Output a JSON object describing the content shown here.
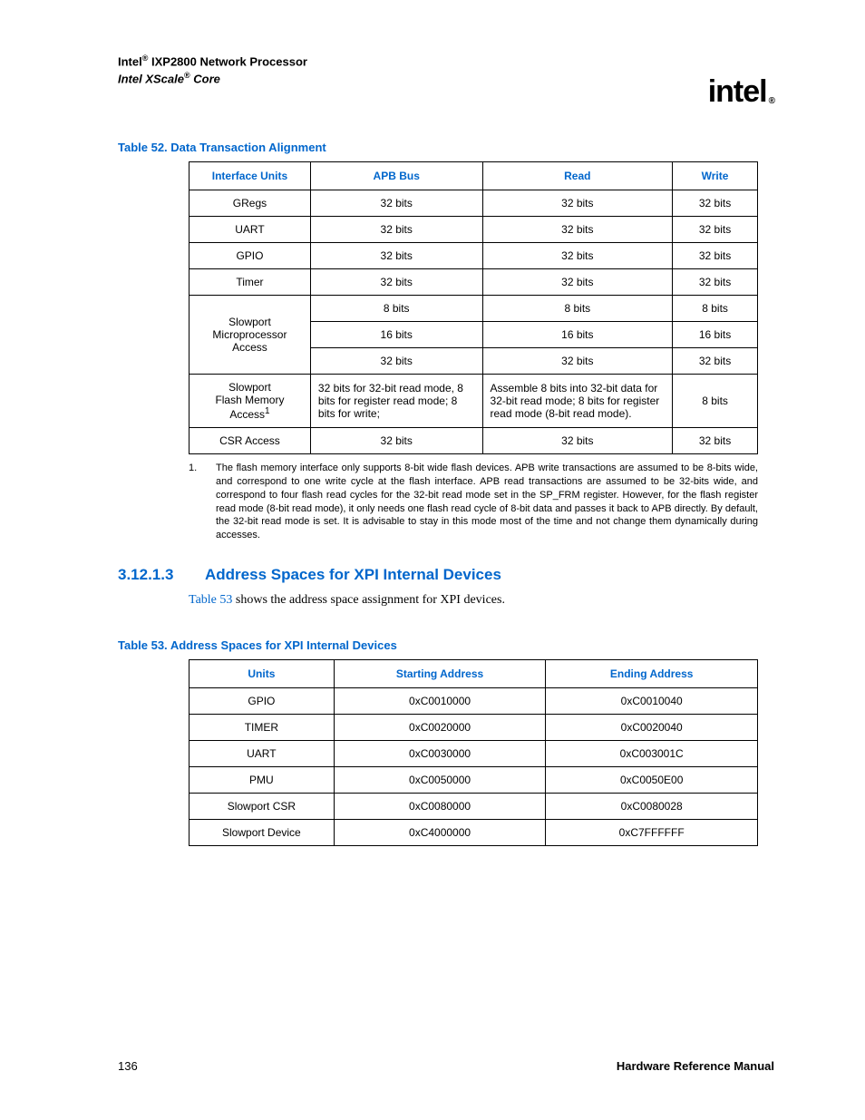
{
  "header": {
    "title_brand": "Intel",
    "title_reg": "®",
    "title_rest": " IXP2800 Network Processor",
    "subtitle_prefix": "Intel XScale",
    "subtitle_reg": "®",
    "subtitle_rest": " Core",
    "logo_text": "intel",
    "logo_reg": "®"
  },
  "table52": {
    "caption_prefix": "Table 52.  ",
    "caption": "Data Transaction Alignment",
    "headers": [
      "Interface Units",
      "APB Bus",
      "Read",
      "Write"
    ],
    "rows": [
      {
        "unit": "GRegs",
        "apb": "32 bits",
        "read": "32 bits",
        "write": "32 bits"
      },
      {
        "unit": "UART",
        "apb": "32 bits",
        "read": "32 bits",
        "write": "32 bits"
      },
      {
        "unit": "GPIO",
        "apb": "32 bits",
        "read": "32 bits",
        "write": "32 bits"
      },
      {
        "unit": "Timer",
        "apb": "32 bits",
        "read": "32 bits",
        "write": "32 bits"
      }
    ],
    "slowport_micro": {
      "label": "Slowport Microprocessor Access",
      "sub": [
        {
          "apb": "8 bits",
          "read": "8 bits",
          "write": "8 bits"
        },
        {
          "apb": "16 bits",
          "read": "16 bits",
          "write": "16 bits"
        },
        {
          "apb": "32 bits",
          "read": "32 bits",
          "write": "32 bits"
        }
      ]
    },
    "slowport_flash": {
      "label_line1": "Slowport",
      "label_line2": "Flash Memory Access",
      "sup": "1",
      "apb": "32 bits for 32-bit read mode, 8 bits for register read mode; 8 bits for write;",
      "read": "Assemble 8 bits into 32-bit data for 32-bit read mode; 8 bits for register read mode (8-bit read mode).",
      "write": "8 bits"
    },
    "csr": {
      "unit": "CSR Access",
      "apb": "32 bits",
      "read": "32 bits",
      "write": "32 bits"
    },
    "footnote_num": "1.",
    "footnote": "The flash memory interface only supports 8-bit wide flash devices. APB write transactions are assumed to be 8-bits wide, and correspond to one write cycle at the flash interface. APB read transactions are assumed to be 32-bits wide, and correspond to four flash read cycles for the 32-bit read mode set in the SP_FRM register. However, for the flash register read mode (8-bit read mode), it only needs one flash read cycle of 8-bit data and passes it back to APB directly. By default, the 32-bit read mode is set. It is advisable to stay in this mode most of the time and not change them dynamically during accesses."
  },
  "section": {
    "num": "3.12.1.3",
    "title": "Address Spaces for XPI Internal Devices",
    "sentence_xref": "Table 53",
    "sentence_rest": " shows the address space assignment for XPI devices."
  },
  "table53": {
    "caption_prefix": "Table 53.  ",
    "caption": "Address Spaces for XPI Internal Devices",
    "headers": [
      "Units",
      "Starting Address",
      "Ending Address"
    ],
    "rows": [
      {
        "unit": "GPIO",
        "start": "0xC0010000",
        "end": "0xC0010040"
      },
      {
        "unit": "TIMER",
        "start": "0xC0020000",
        "end": "0xC0020040"
      },
      {
        "unit": "UART",
        "start": "0xC0030000",
        "end": "0xC003001C"
      },
      {
        "unit": "PMU",
        "start": "0xC0050000",
        "end": "0xC0050E00"
      },
      {
        "unit": "Slowport CSR",
        "start": "0xC0080000",
        "end": "0xC0080028"
      },
      {
        "unit": "Slowport Device",
        "start": "0xC4000000",
        "end": "0xC7FFFFFF"
      }
    ]
  },
  "footer": {
    "page": "136",
    "manual": "Hardware Reference Manual"
  }
}
